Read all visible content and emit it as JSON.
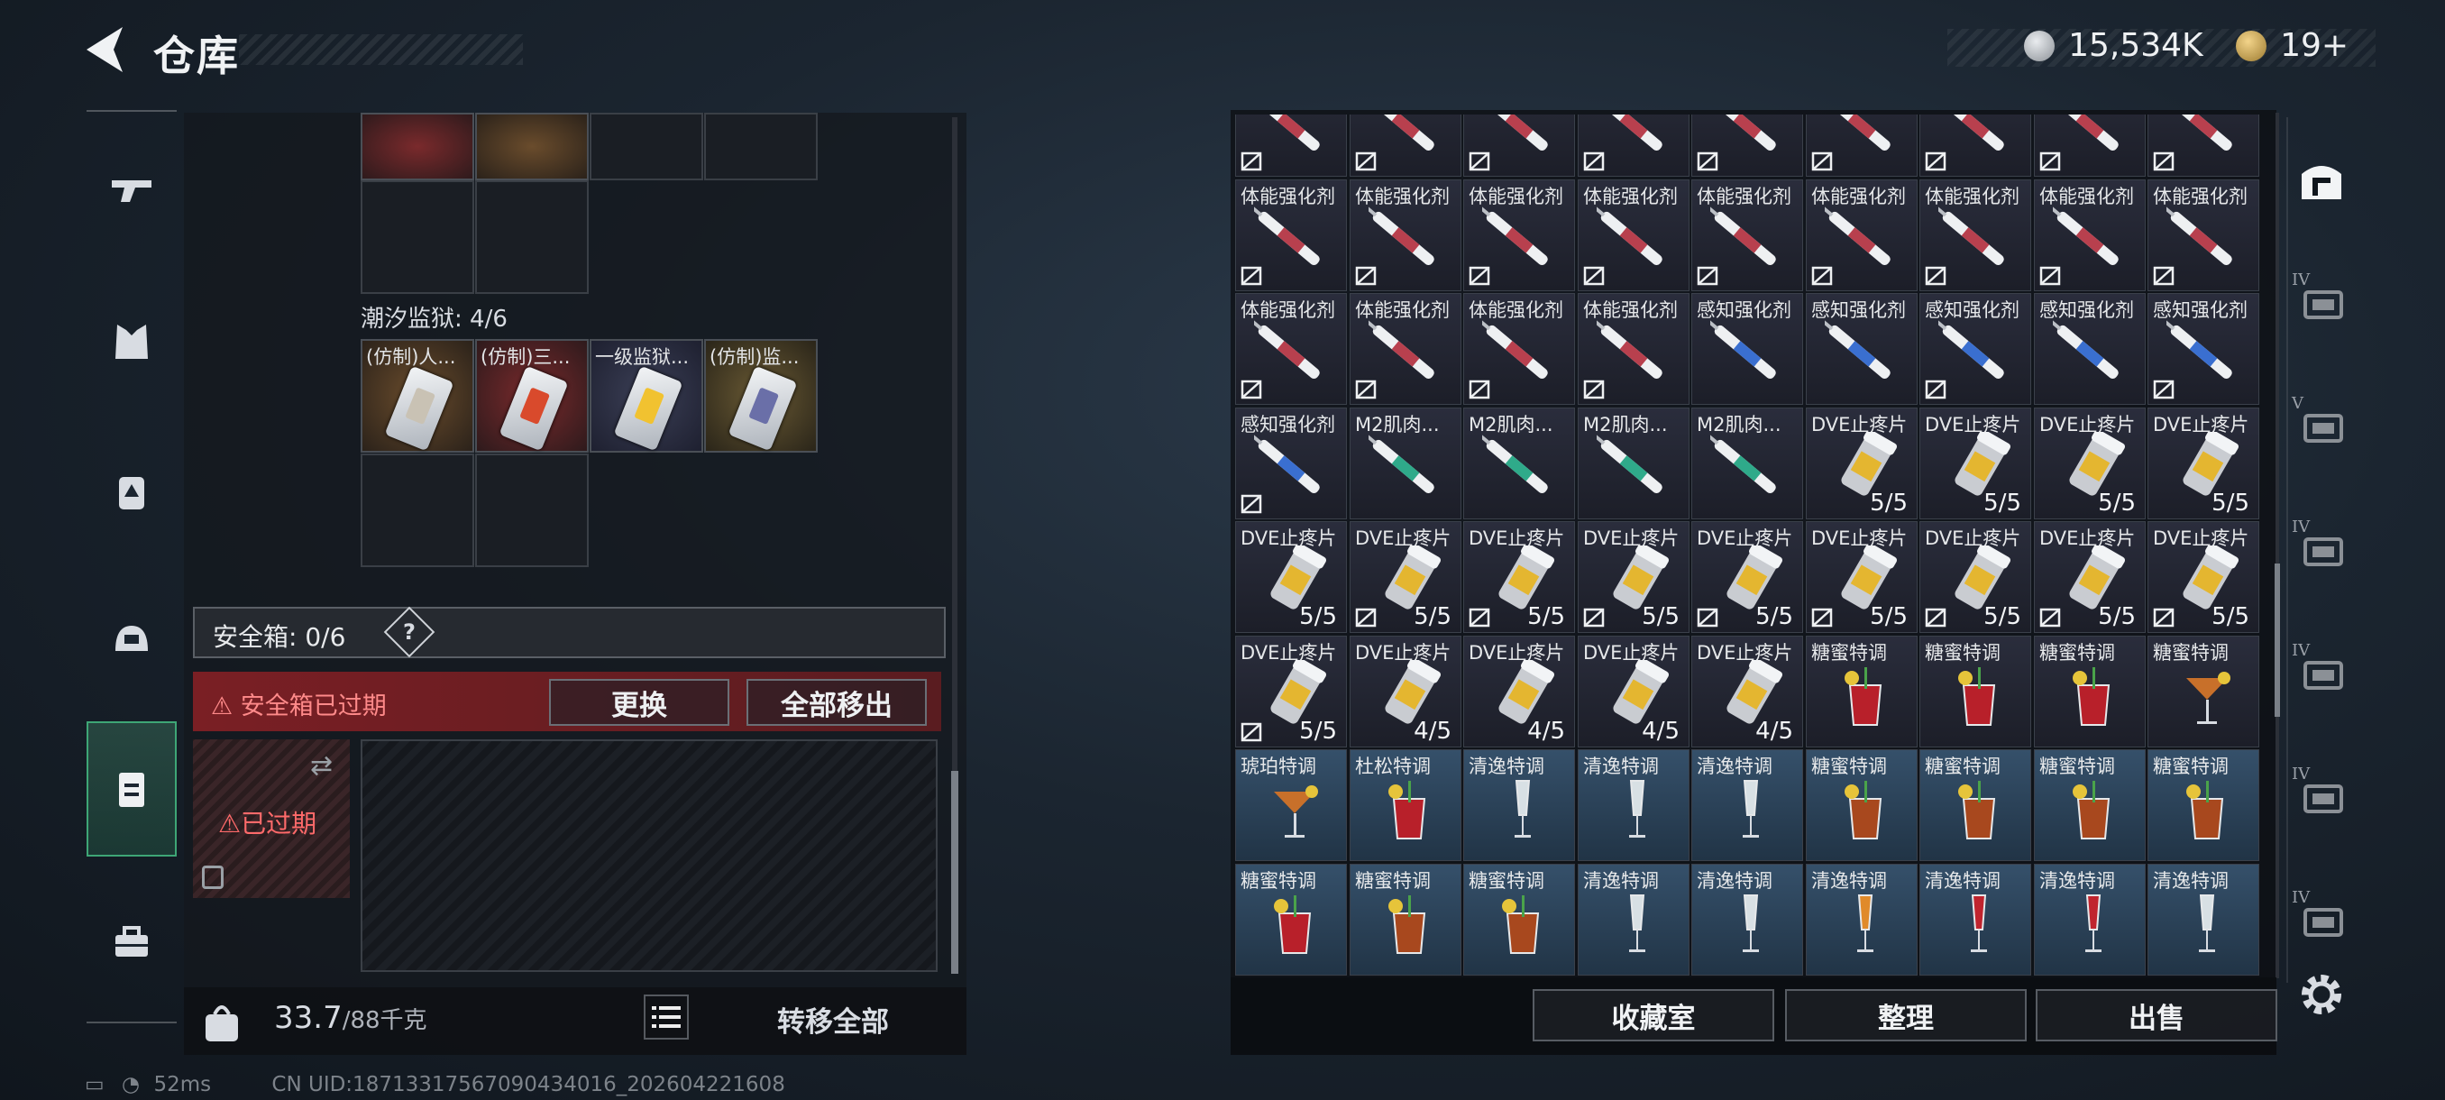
{
  "header": {
    "title": "仓库",
    "currency_value": "15,534K",
    "currency2_value": "19+"
  },
  "left_panel": {
    "prison_label": "潮汐监狱: 4/6",
    "prison_items": [
      {
        "name": "(仿制)人...",
        "color": "orange"
      },
      {
        "name": "(仿制)三...",
        "color": "red"
      },
      {
        "name": "一级监狱...",
        "color": "dark"
      },
      {
        "name": "(仿制)监...",
        "color": "gold"
      }
    ],
    "safebox_label": "安全箱: 0/6",
    "help": "?",
    "expired_warning": "安全箱已过期",
    "replace_button": "更换",
    "move_all_button": "全部移出",
    "safebox_expired": "已过期",
    "weight_value": "33.7",
    "weight_unit": "/88千克",
    "transfer_all_button": "转移全部"
  },
  "status_bar": {
    "ping": "52ms",
    "uid": "CN UID:18713317567090434016_202604221608"
  },
  "inventory": {
    "rows": [
      [
        {
          "name": "",
          "type": "syringe-red",
          "nolock": true
        },
        {
          "name": "",
          "type": "syringe-red",
          "nolock": true
        },
        {
          "name": "",
          "type": "syringe-red",
          "nolock": true
        },
        {
          "name": "",
          "type": "syringe-red",
          "nolock": true
        },
        {
          "name": "",
          "type": "syringe-red",
          "nolock": true
        },
        {
          "name": "",
          "type": "syringe-red",
          "nolock": true
        },
        {
          "name": "",
          "type": "syringe-red",
          "nolock": true
        },
        {
          "name": "",
          "type": "syringe-red",
          "nolock": true
        },
        {
          "name": "",
          "type": "syringe-red",
          "nolock": true
        }
      ],
      [
        {
          "name": "体能强化剂",
          "type": "syringe-red",
          "nolock": true
        },
        {
          "name": "体能强化剂",
          "type": "syringe-red",
          "nolock": true
        },
        {
          "name": "体能强化剂",
          "type": "syringe-red",
          "nolock": true
        },
        {
          "name": "体能强化剂",
          "type": "syringe-red",
          "nolock": true
        },
        {
          "name": "体能强化剂",
          "type": "syringe-red",
          "nolock": true
        },
        {
          "name": "体能强化剂",
          "type": "syringe-red",
          "nolock": true
        },
        {
          "name": "体能强化剂",
          "type": "syringe-red",
          "nolock": true
        },
        {
          "name": "体能强化剂",
          "type": "syringe-red",
          "nolock": true
        },
        {
          "name": "体能强化剂",
          "type": "syringe-red",
          "nolock": true
        }
      ],
      [
        {
          "name": "体能强化剂",
          "type": "syringe-red",
          "nolock": true
        },
        {
          "name": "体能强化剂",
          "type": "syringe-red",
          "nolock": true
        },
        {
          "name": "体能强化剂",
          "type": "syringe-red",
          "nolock": true
        },
        {
          "name": "体能强化剂",
          "type": "syringe-red",
          "nolock": true
        },
        {
          "name": "感知强化剂",
          "type": "syringe-blue",
          "nolock": false
        },
        {
          "name": "感知强化剂",
          "type": "syringe-blue",
          "nolock": false
        },
        {
          "name": "感知强化剂",
          "type": "syringe-blue",
          "nolock": true
        },
        {
          "name": "感知强化剂",
          "type": "syringe-blue",
          "nolock": false
        },
        {
          "name": "感知强化剂",
          "type": "syringe-blue",
          "nolock": true
        }
      ],
      [
        {
          "name": "感知强化剂",
          "type": "syringe-blue",
          "nolock": true
        },
        {
          "name": "M2肌肉...",
          "type": "syringe-green",
          "nolock": false
        },
        {
          "name": "M2肌肉...",
          "type": "syringe-green",
          "nolock": false
        },
        {
          "name": "M2肌肉...",
          "type": "syringe-green",
          "nolock": false
        },
        {
          "name": "M2肌肉...",
          "type": "syringe-green",
          "nolock": false
        },
        {
          "name": "DVE止疼片",
          "type": "pills",
          "count": "5/5"
        },
        {
          "name": "DVE止疼片",
          "type": "pills",
          "count": "5/5"
        },
        {
          "name": "DVE止疼片",
          "type": "pills",
          "count": "5/5"
        },
        {
          "name": "DVE止疼片",
          "type": "pills",
          "count": "5/5"
        }
      ],
      [
        {
          "name": "DVE止疼片",
          "type": "pills",
          "count": "5/5"
        },
        {
          "name": "DVE止疼片",
          "type": "pills",
          "count": "5/5",
          "nolock": true
        },
        {
          "name": "DVE止疼片",
          "type": "pills",
          "count": "5/5",
          "nolock": true
        },
        {
          "name": "DVE止疼片",
          "type": "pills",
          "count": "5/5",
          "nolock": true
        },
        {
          "name": "DVE止疼片",
          "type": "pills",
          "count": "5/5",
          "nolock": true
        },
        {
          "name": "DVE止疼片",
          "type": "pills",
          "count": "5/5",
          "nolock": true
        },
        {
          "name": "DVE止疼片",
          "type": "pills",
          "count": "5/5",
          "nolock": true
        },
        {
          "name": "DVE止疼片",
          "type": "pills",
          "count": "5/5",
          "nolock": true
        },
        {
          "name": "DVE止疼片",
          "type": "pills",
          "count": "5/5",
          "nolock": true
        }
      ],
      [
        {
          "name": "DVE止疼片",
          "type": "pills",
          "count": "5/5",
          "nolock": true
        },
        {
          "name": "DVE止疼片",
          "type": "pills",
          "count": "4/5"
        },
        {
          "name": "DVE止疼片",
          "type": "pills",
          "count": "4/5"
        },
        {
          "name": "DVE止疼片",
          "type": "pills",
          "count": "4/5"
        },
        {
          "name": "DVE止疼片",
          "type": "pills",
          "count": "4/5"
        },
        {
          "name": "糖蜜特调",
          "type": "drink-red"
        },
        {
          "name": "糖蜜特调",
          "type": "drink-red"
        },
        {
          "name": "糖蜜特调",
          "type": "drink-red"
        },
        {
          "name": "糖蜜特调",
          "type": "cocktail"
        }
      ],
      [
        {
          "name": "琥珀特调",
          "type": "cocktail"
        },
        {
          "name": "杜松特调",
          "type": "drink-red"
        },
        {
          "name": "清逸特调",
          "type": "flute"
        },
        {
          "name": "清逸特调",
          "type": "flute"
        },
        {
          "name": "清逸特调",
          "type": "flute"
        },
        {
          "name": "糖蜜特调",
          "type": "drink-amber"
        },
        {
          "name": "糖蜜特调",
          "type": "drink-amber"
        },
        {
          "name": "糖蜜特调",
          "type": "drink-amber"
        },
        {
          "name": "糖蜜特调",
          "type": "drink-amber"
        }
      ],
      [
        {
          "name": "糖蜜特调",
          "type": "drink-red"
        },
        {
          "name": "糖蜜特调",
          "type": "drink-amber"
        },
        {
          "name": "糖蜜特调",
          "type": "drink-amber"
        },
        {
          "name": "清逸特调",
          "type": "flute"
        },
        {
          "name": "清逸特调",
          "type": "flute"
        },
        {
          "name": "清逸特调",
          "type": "flute-orange"
        },
        {
          "name": "清逸特调",
          "type": "flute-red"
        },
        {
          "name": "清逸特调",
          "type": "flute-red"
        },
        {
          "name": "清逸特调",
          "type": "flute"
        }
      ]
    ],
    "blue_rows": [
      6,
      7
    ]
  },
  "actions": {
    "collection": "收藏室",
    "organize": "整理",
    "sell": "出售"
  },
  "right_rail_tiers": [
    "IV",
    "V",
    "IV",
    "IV",
    "IV",
    "IV"
  ],
  "colors": {
    "accent_green": "#3ea676",
    "warning_red": "#7a1f24"
  }
}
